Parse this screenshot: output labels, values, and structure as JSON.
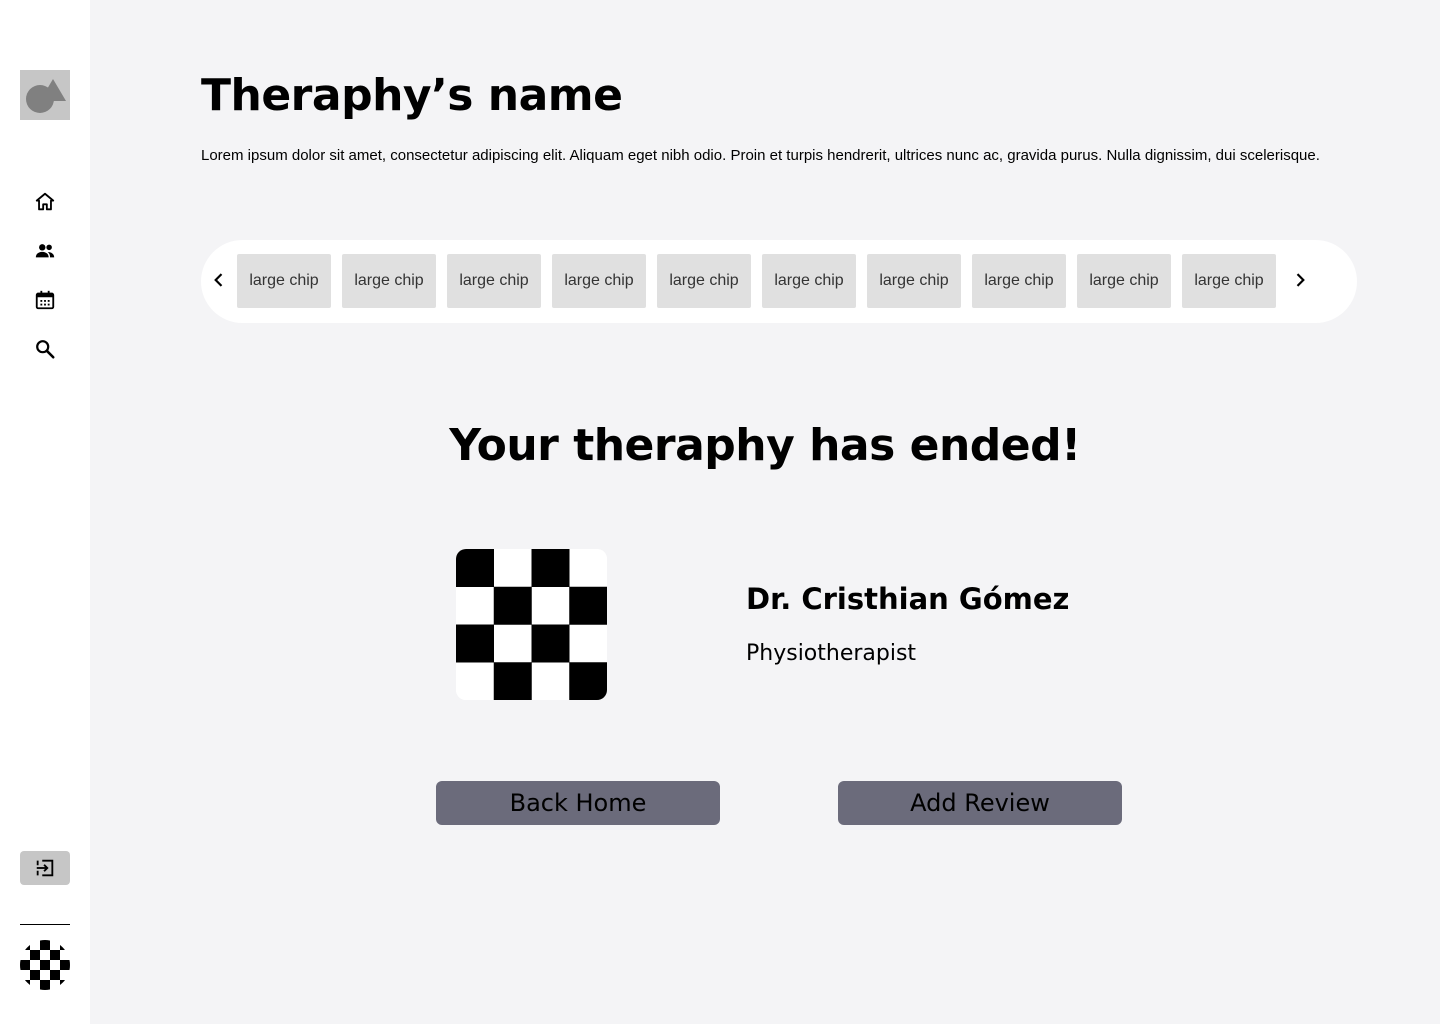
{
  "sidebar": {
    "logo_icon": "shapes-logo-icon",
    "nav": [
      {
        "id": "home",
        "icon": "home-icon"
      },
      {
        "id": "people",
        "icon": "people-icon"
      },
      {
        "id": "calendar",
        "icon": "calendar-icon"
      },
      {
        "id": "search",
        "icon": "search-icon"
      }
    ],
    "logout_icon": "logout-icon",
    "avatar_icon": "checker-avatar"
  },
  "header": {
    "title": "Theraphy’s name",
    "description": "Lorem ipsum dolor sit amet, consectetur adipiscing elit. Aliquam eget nibh odio. Proin et turpis hendrerit, ultrices nunc ac, gravida purus. Nulla dignissim, dui scelerisque."
  },
  "chips": [
    {
      "label": "large chip"
    },
    {
      "label": "large chip"
    },
    {
      "label": "large chip"
    },
    {
      "label": "large chip"
    },
    {
      "label": "large chip"
    },
    {
      "label": "large chip"
    },
    {
      "label": "large chip"
    },
    {
      "label": "large chip"
    },
    {
      "label": "large chip"
    },
    {
      "label": "large chip"
    }
  ],
  "main": {
    "heading": "Your theraphy has ended!",
    "doctor": {
      "name": "Dr. Cristhian Gómez",
      "role": "Physiotherapist"
    },
    "buttons": {
      "back_home": "Back Home",
      "add_review": "Add Review"
    }
  },
  "colors": {
    "page_bg": "#f4f4f6",
    "sidebar_bg": "#ffffff",
    "chip_bg": "#e0e0e0",
    "button_bg": "#6b6b7b",
    "logo_bg": "#c6c6c6"
  }
}
